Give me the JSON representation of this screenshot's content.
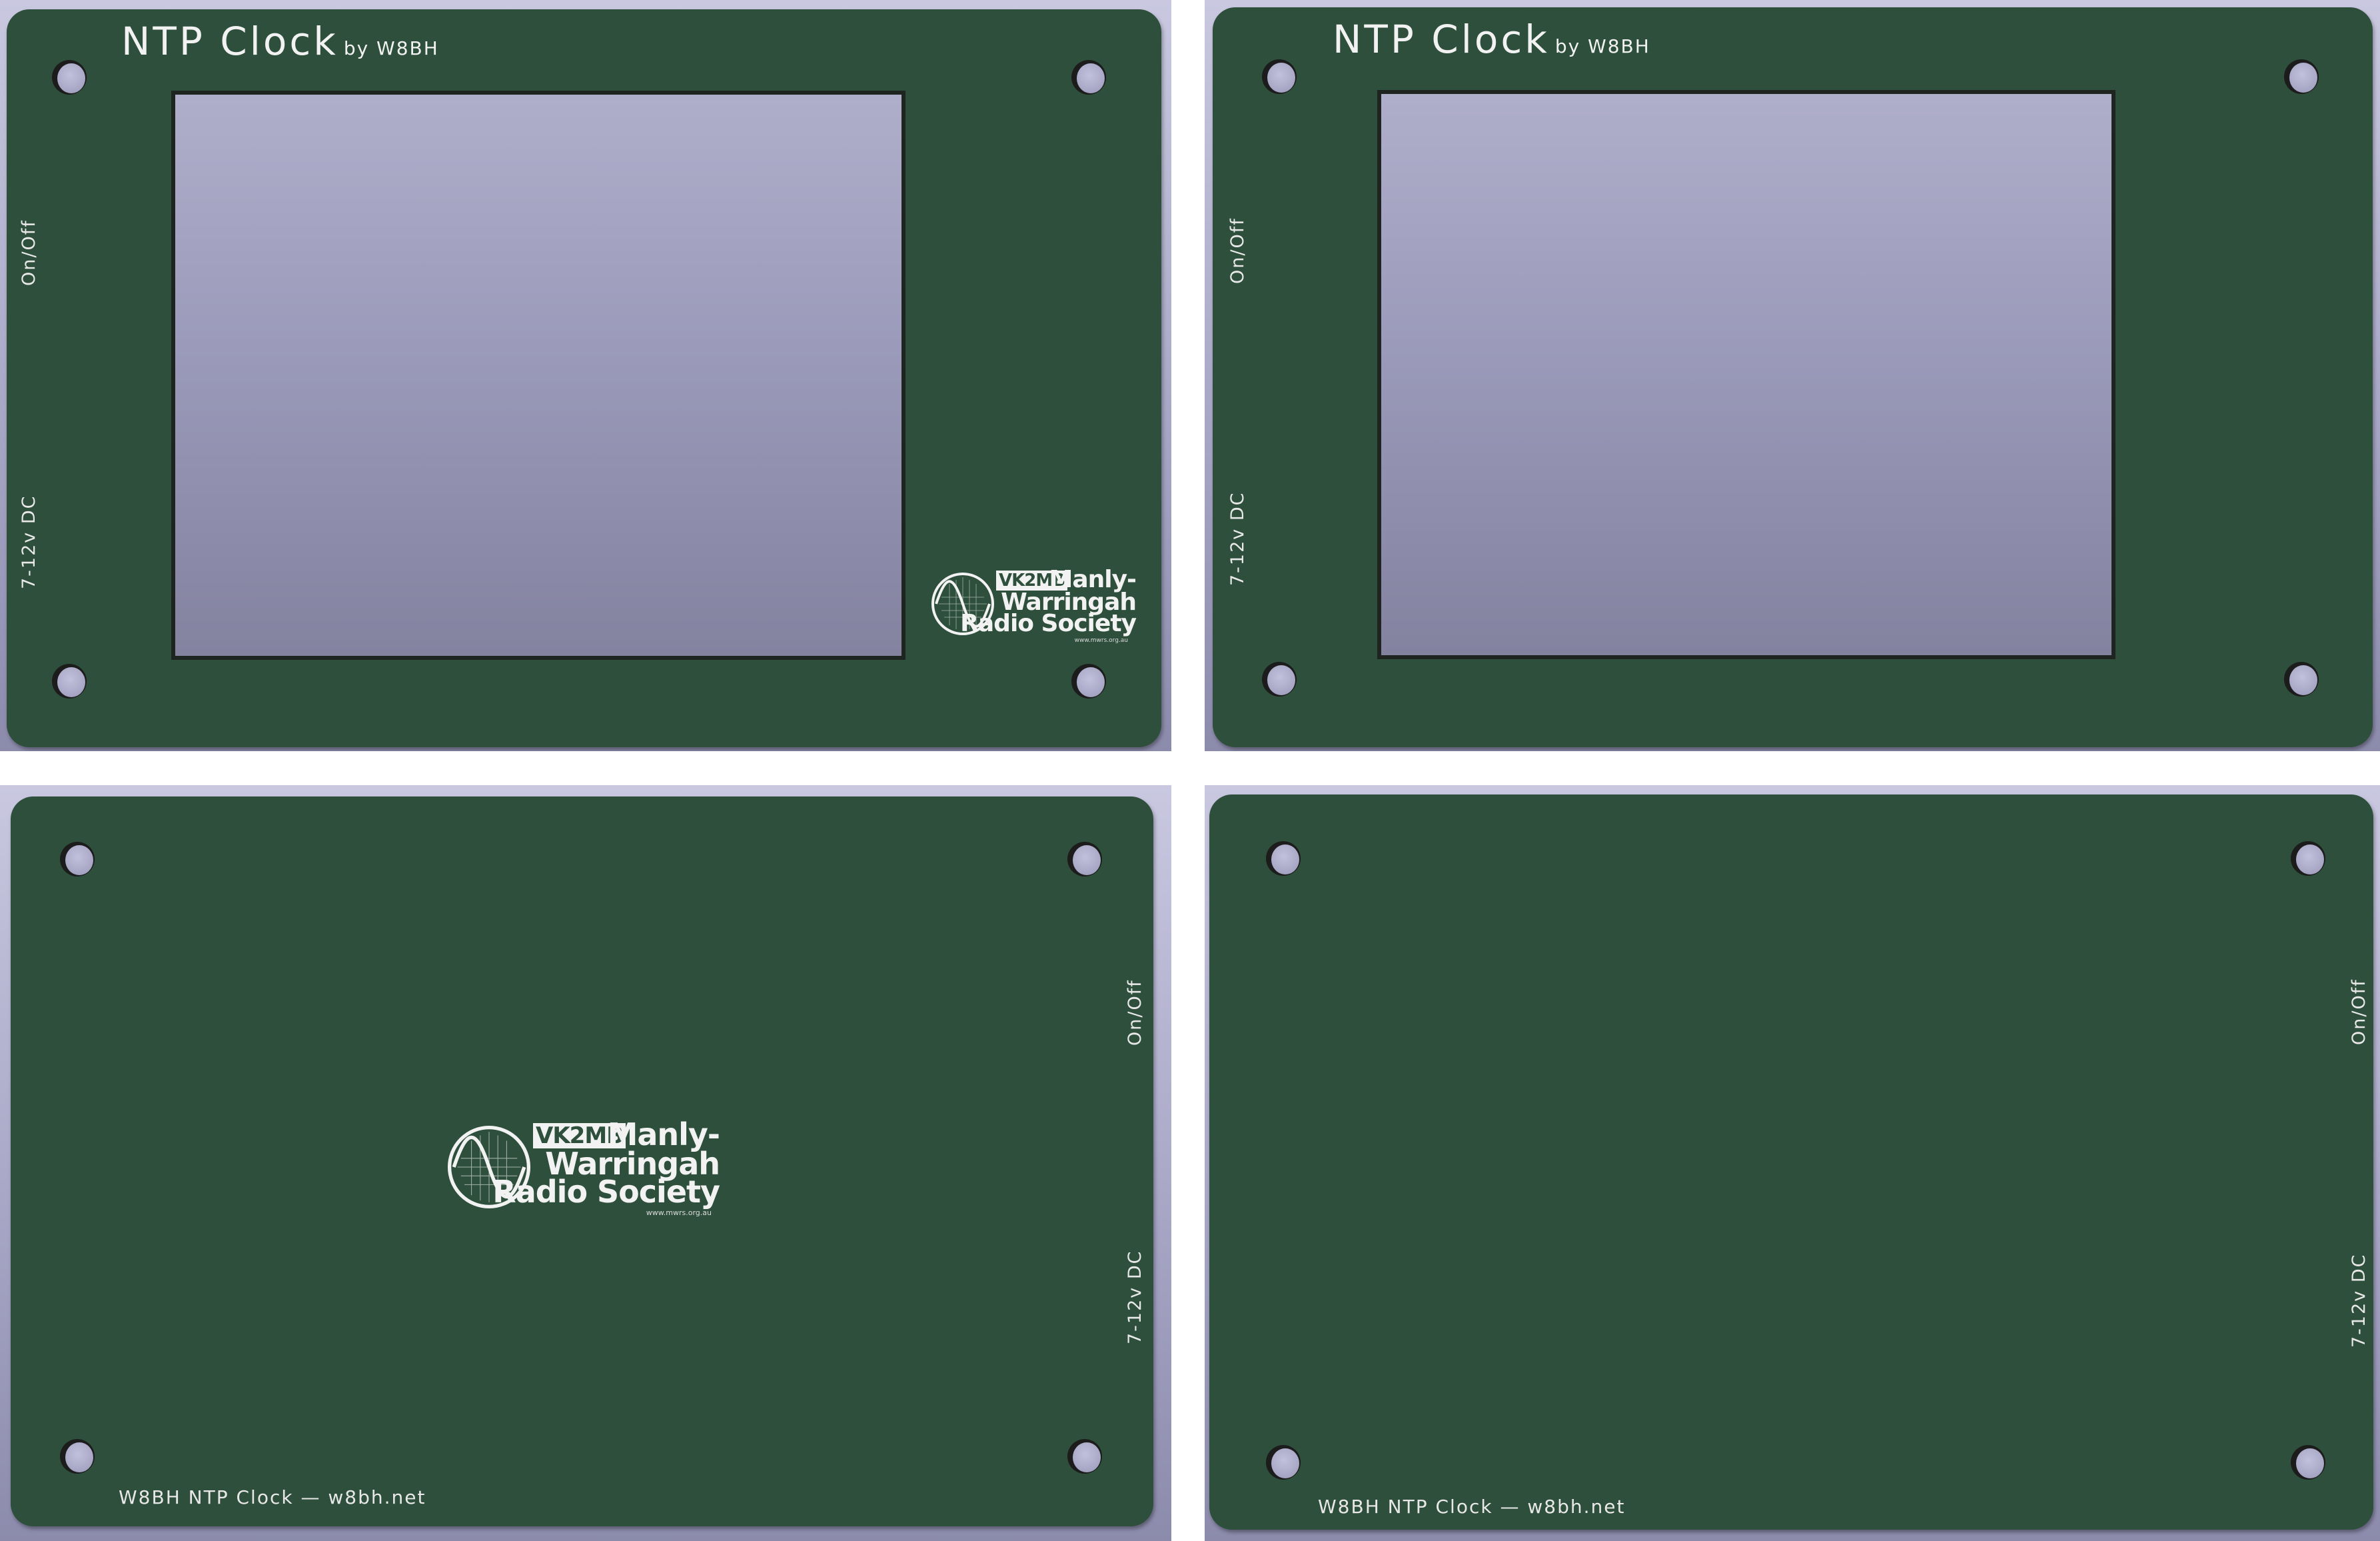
{
  "panels": {
    "front_a": {
      "title": "NTP Clock",
      "subtitle": "by W8BH",
      "label_switch": "On/Off",
      "label_power": "7-12v DC"
    },
    "front_b": {
      "title": "NTP Clock",
      "subtitle": "by W8BH",
      "label_switch": "On/Off",
      "label_power": "7-12v DC"
    },
    "back_a": {
      "label_switch": "On/Off",
      "label_power": "7-12v DC",
      "footer": "W8BH NTP Clock — w8bh.net"
    },
    "back_b": {
      "label_switch": "On/Off",
      "label_power": "7-12v DC",
      "footer": "W8BH NTP Clock — w8bh.net"
    }
  },
  "logo": {
    "callsign": "VK2MB",
    "line1": "Manly-",
    "line2": "Warringah",
    "line3": "Radio Society",
    "url": "www.mwrs.org.au"
  },
  "colors": {
    "board": "#2d4f3b",
    "screen": "#9b9aba",
    "background": "#a8a7c6",
    "silkscreen": "#f2f2f2"
  }
}
